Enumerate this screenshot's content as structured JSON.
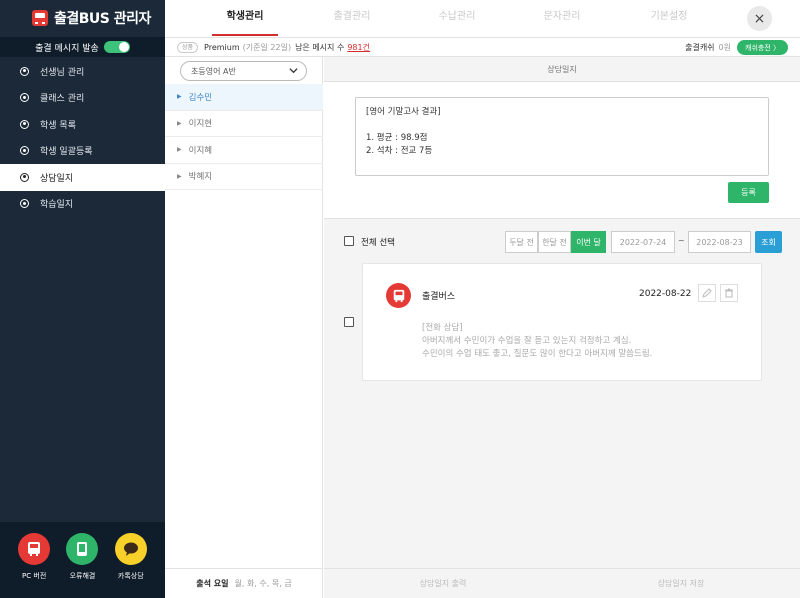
{
  "app": {
    "title": "출결BUS 관리자"
  },
  "sidebar": {
    "message_toggle_label": "출결 메시지 발송",
    "message_toggle_on": true,
    "items": [
      {
        "label": "선생님 관리",
        "active": false
      },
      {
        "label": "클래스 관리",
        "active": false
      },
      {
        "label": "학생 목록",
        "active": false
      },
      {
        "label": "학생 일괄등록",
        "active": false
      },
      {
        "label": "상담일지",
        "active": true
      },
      {
        "label": "학습일지",
        "active": false
      }
    ],
    "bottom_buttons": [
      {
        "label": "PC 버전",
        "icon": "bus-icon",
        "color": "#e53935"
      },
      {
        "label": "오류해결",
        "icon": "phone-icon",
        "color": "#2fb56a"
      },
      {
        "label": "카톡상담",
        "icon": "chat-bubble-icon",
        "color": "#f7d02a"
      }
    ]
  },
  "topnav": {
    "tabs": [
      {
        "label": "학생관리",
        "active": true
      },
      {
        "label": "출결관리",
        "active": false
      },
      {
        "label": "수납관리",
        "active": false
      },
      {
        "label": "문자관리",
        "active": false
      },
      {
        "label": "기본설정",
        "active": false
      }
    ],
    "close_icon": "×"
  },
  "infobar": {
    "badge": "상품",
    "plan": "Premium",
    "plan_note": "(기준일 22일)",
    "remaining_label": "남은 메시지 수",
    "remaining_value": "981건",
    "cash_label": "출결캐쉬",
    "cash_value": "0원",
    "charge_button": "캐쉬충전 〉"
  },
  "student_panel": {
    "class_select": "초등영어 A반",
    "students": [
      {
        "name": "김수민",
        "active": true
      },
      {
        "name": "이지현",
        "active": false
      },
      {
        "name": "이지혜",
        "active": false
      },
      {
        "name": "박혜지",
        "active": false
      }
    ],
    "attendance_label": "출석 요일",
    "attendance_days": "월, 화, 수, 목, 금"
  },
  "content": {
    "title": "상담일지",
    "editor_text": "[영어 기말고사 결과]\n\n1. 평균 : 98.9점\n2. 석차 : 전교 7등",
    "submit_button": "등록",
    "select_all": "전체 선택",
    "periods": [
      {
        "label": "두달 전",
        "active": false
      },
      {
        "label": "한달 전",
        "active": false
      },
      {
        "label": "이번 달",
        "active": true
      }
    ],
    "date_from": "2022-07-24",
    "date_sep": "~",
    "date_to": "2022-08-23",
    "search_button": "조회",
    "entries": [
      {
        "author": "출결버스",
        "date": "2022-08-22",
        "body": "[전화 상담]\n아버지께서 수민이가 수업을 잘 듣고 있는지 걱정하고 계심.\n수민이의 수업 태도 좋고, 질문도 많이 한다고 아버지께 말씀드림."
      }
    ],
    "print_button": "상담일지 출력",
    "save_button": "상담일지 저장"
  }
}
